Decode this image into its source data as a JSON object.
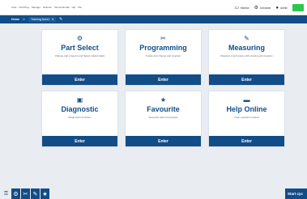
{
  "menubar": {
    "items": [
      "Area",
      "Part/Prog",
      "Manage",
      "Network",
      "Service/Install",
      "Hlp",
      "File"
    ],
    "user_status": "Monitor",
    "tool_status": "Unknown",
    "user_name": "Admin"
  },
  "navbar": {
    "home_label": "Home",
    "crumb_label": "Training Area1"
  },
  "cards": [
    {
      "title": "Part Select",
      "description": "Change part program and Select related tasks",
      "enter": "Enter"
    },
    {
      "title": "Programming",
      "description": "Create and change part program",
      "enter": "Enter"
    },
    {
      "title": "Measuring",
      "description": "Measure a work piece with existing part program",
      "enter": "Enter"
    },
    {
      "title": "Diagnostic",
      "description": "Diagnostics functions",
      "enter": "Enter"
    },
    {
      "title": "Favourite",
      "description": "Favourite parts and groups",
      "enter": "Enter"
    },
    {
      "title": "Help Online",
      "description": "Open operator manual",
      "enter": "Enter"
    }
  ],
  "bottom": {
    "start_label": "Start cyc"
  },
  "colors": {
    "primary": "#124d88",
    "status_ok": "#2cc84d",
    "background": "#e9edf1"
  },
  "icons": [
    "home-icon",
    "pencil-icon",
    "part-select-icon",
    "programming-icon",
    "measuring-icon",
    "diagnostic-icon",
    "favourite-icon",
    "help-online-icon",
    "monitor-icon",
    "user-icon"
  ]
}
